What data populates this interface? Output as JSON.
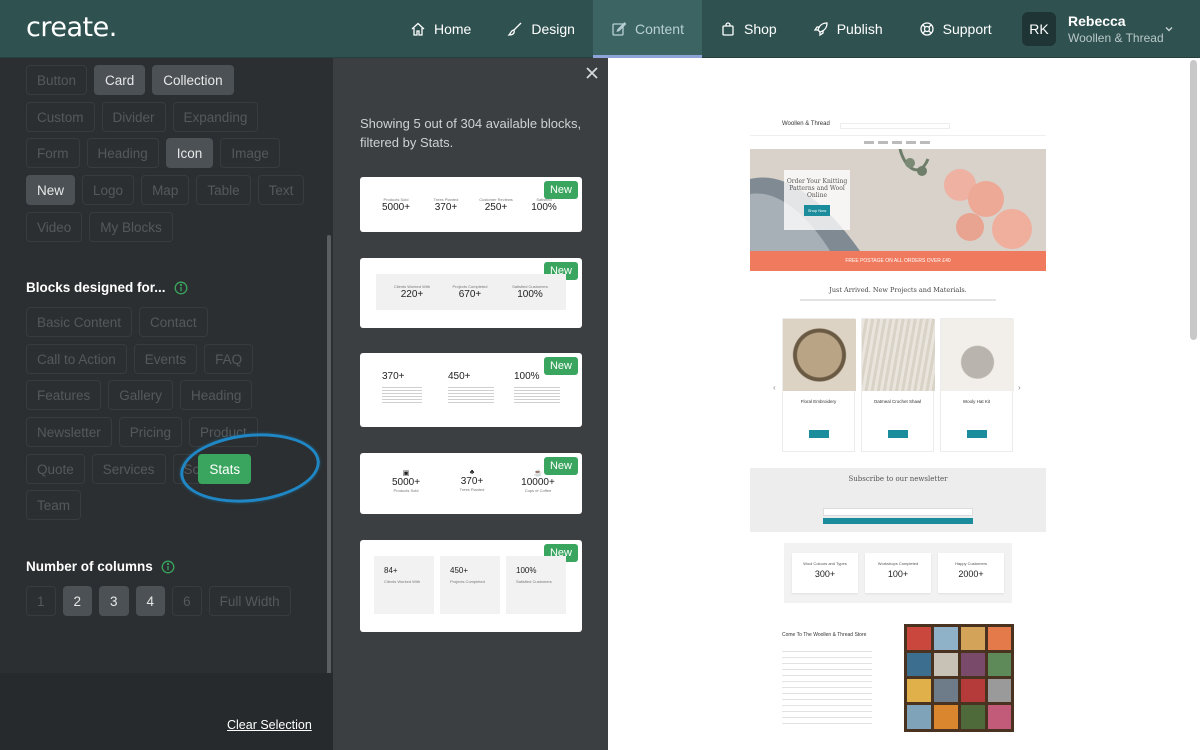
{
  "app": {
    "logo": "create."
  },
  "nav": {
    "items": [
      {
        "label": "Home",
        "icon": "home-icon"
      },
      {
        "label": "Design",
        "icon": "brush-icon"
      },
      {
        "label": "Content",
        "icon": "edit-icon",
        "active": true
      },
      {
        "label": "Shop",
        "icon": "shopping-bag-icon"
      },
      {
        "label": "Publish",
        "icon": "rocket-icon"
      },
      {
        "label": "Support",
        "icon": "lifebuoy-icon"
      }
    ],
    "user": {
      "initials": "RK",
      "name": "Rebecca",
      "store": "Woollen & Thread"
    }
  },
  "filters": {
    "types": {
      "row1": [
        "Button",
        "Card",
        "Collection"
      ],
      "row2": [
        "Custom",
        "Divider",
        "Expanding"
      ],
      "row3": [
        "Form",
        "Heading",
        "Icon",
        "Image"
      ],
      "row4": [
        "New",
        "Logo",
        "Map",
        "Table",
        "Text"
      ],
      "row5": [
        "Video",
        "My Blocks"
      ],
      "selected": [
        "Card",
        "Collection",
        "Icon",
        "New"
      ]
    },
    "designed_for": {
      "title": "Blocks designed for...",
      "row1": [
        "Basic Content",
        "Contact"
      ],
      "row2": [
        "Call to Action",
        "Events",
        "FAQ"
      ],
      "row3": [
        "Features",
        "Gallery",
        "Heading"
      ],
      "row4": [
        "Newsletter",
        "Pricing",
        "Product"
      ],
      "row5": [
        "Quote",
        "Services",
        "Social",
        "Stats"
      ],
      "row6": [
        "Team"
      ],
      "selected": "Stats"
    },
    "columns": {
      "title": "Number of columns",
      "options": [
        "1",
        "2",
        "3",
        "4",
        "6",
        "Full Width"
      ],
      "selected": [
        "2",
        "3",
        "4"
      ]
    },
    "clear_label": "Clear Selection"
  },
  "results": {
    "summary": "Showing 5 out of 304 available blocks, filtered by Stats.",
    "badge": "New",
    "cards": [
      {
        "stats": [
          {
            "label": "Products Sold",
            "value": "5000+"
          },
          {
            "label": "Trees Planted",
            "value": "370+"
          },
          {
            "label": "Customer Reviews",
            "value": "250+"
          },
          {
            "label": "Satisfied",
            "value": "100%"
          }
        ]
      },
      {
        "stats": [
          {
            "label": "Clients Worked With",
            "value": "220+"
          },
          {
            "label": "Projects Completed",
            "value": "670+"
          },
          {
            "label": "Satisfied Customers",
            "value": "100%"
          }
        ]
      },
      {
        "stats": [
          {
            "label": "",
            "value": "370+"
          },
          {
            "label": "",
            "value": "450+"
          },
          {
            "label": "",
            "value": "100%"
          }
        ]
      },
      {
        "stats": [
          {
            "label": "Products Sold",
            "value": "5000+"
          },
          {
            "label": "Trees Planted",
            "value": "370+"
          },
          {
            "label": "Cups of Coffee",
            "value": "10000+"
          }
        ]
      },
      {
        "stats": [
          {
            "label": "Clients Worked With",
            "value": "84+"
          },
          {
            "label": "Projects Completed",
            "value": "450+"
          },
          {
            "label": "Satisfied Customers",
            "value": "100%"
          }
        ]
      }
    ]
  },
  "preview": {
    "brand": "Woollen & Thread",
    "hero_title": "Order Your Knitting Patterns and Wool Online",
    "hero_button": "Shop Now",
    "banner": "FREE POSTAGE ON ALL ORDERS OVER £40",
    "section_title": "Just Arrived. New Projects and Materials.",
    "products": [
      "Floral Embroidery",
      "Oatmeal Crochet Shawl",
      "Wooly Hat Kit"
    ],
    "newsletter_title": "Subscribe to our newsletter",
    "stats": [
      {
        "label": "Wool Colours and Types",
        "value": "300+"
      },
      {
        "label": "Workshops Completed",
        "value": "100+"
      },
      {
        "label": "Happy Customers",
        "value": "2000+"
      }
    ],
    "store_title": "Come To The Woollen & Thread Store"
  }
}
